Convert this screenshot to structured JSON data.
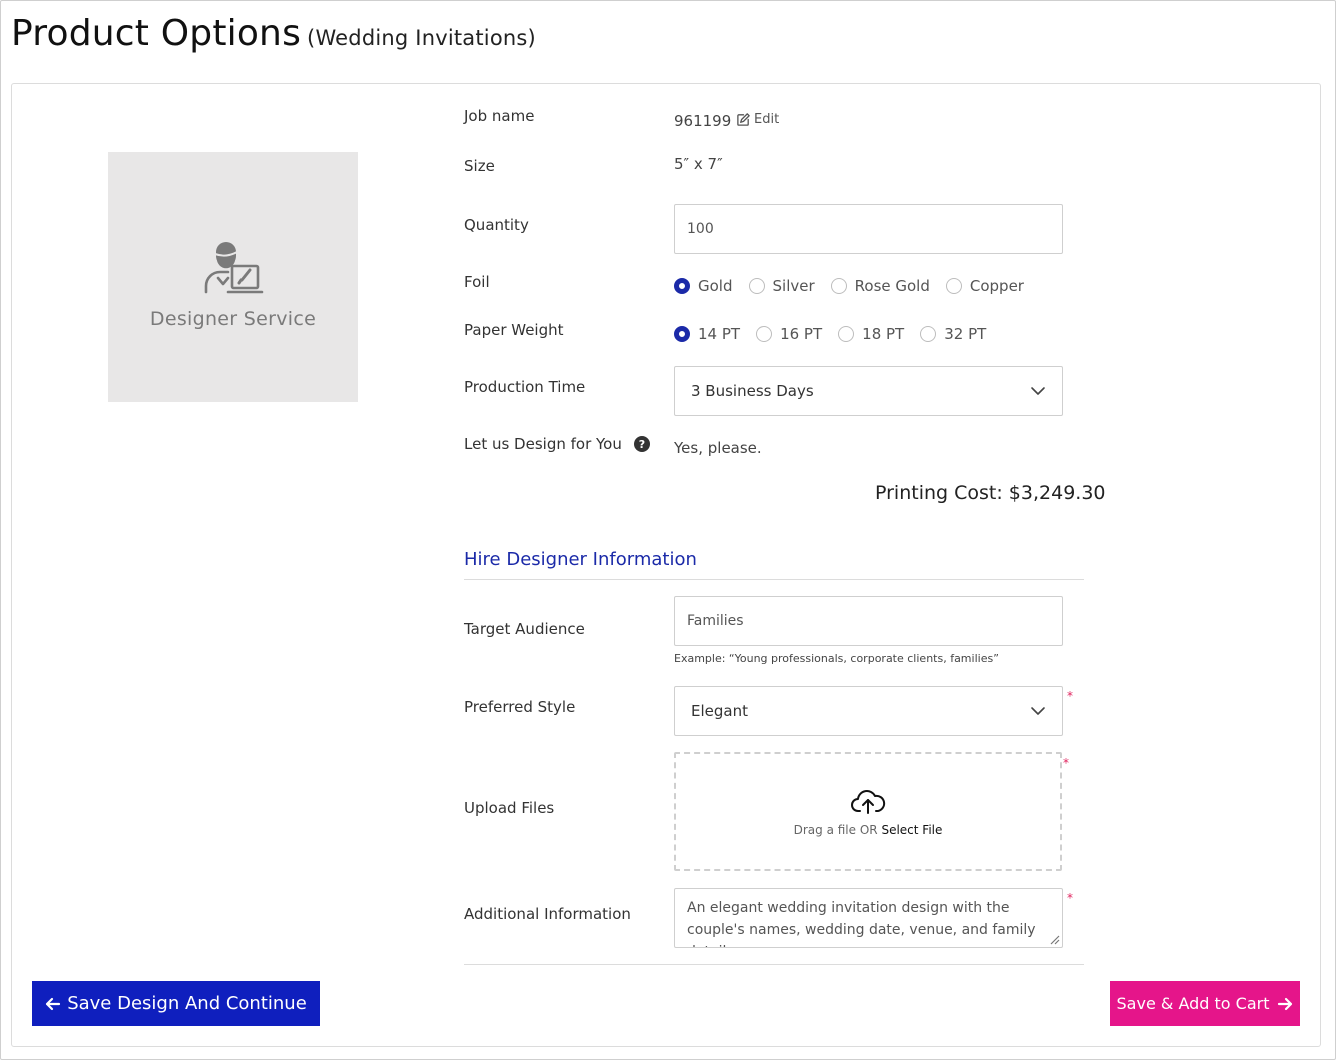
{
  "page": {
    "title": "Product Options",
    "subtitle": "(Wedding Invitations)"
  },
  "preview": {
    "label": "Designer Service",
    "icon": "designer-service-icon"
  },
  "form": {
    "job_name": {
      "label": "Job name",
      "value": "961199",
      "edit_label": "Edit"
    },
    "size": {
      "label": "Size",
      "value": "5″ x 7″"
    },
    "quantity": {
      "label": "Quantity",
      "value": "100"
    },
    "foil": {
      "label": "Foil",
      "options": [
        "Gold",
        "Silver",
        "Rose Gold",
        "Copper"
      ],
      "selected": "Gold"
    },
    "paper_weight": {
      "label": "Paper Weight",
      "options": [
        "14 PT",
        "16 PT",
        "18 PT",
        "32 PT"
      ],
      "selected": "14 PT"
    },
    "production_time": {
      "label": "Production Time",
      "value": "3 Business Days"
    },
    "design_for_you": {
      "label": "Let us Design for You",
      "value": "Yes, please."
    },
    "printing_cost": "Printing Cost: $3,249.30"
  },
  "designer": {
    "section_title": "Hire Designer Information",
    "target_audience": {
      "label": "Target Audience",
      "value": "Families",
      "hint": "Example: “Young professionals, corporate clients, families”"
    },
    "preferred_style": {
      "label": "Preferred Style",
      "value": "Elegant"
    },
    "upload_files": {
      "label": "Upload Files",
      "drop_text": "Drag a file OR",
      "select_text": "Select File"
    },
    "additional_info": {
      "label": "Additional Information",
      "value": "An elegant wedding invitation design with the couple's names, wedding date, venue, and family details."
    },
    "required_marker": "*"
  },
  "actions": {
    "save_continue": "Save Design And Continue",
    "add_to_cart": "Save & Add to Cart"
  },
  "colors": {
    "accent_blue": "#1b2aa8",
    "primary_button": "#0f1fbe",
    "cart_button": "#e5158a",
    "required": "#e0245e"
  }
}
